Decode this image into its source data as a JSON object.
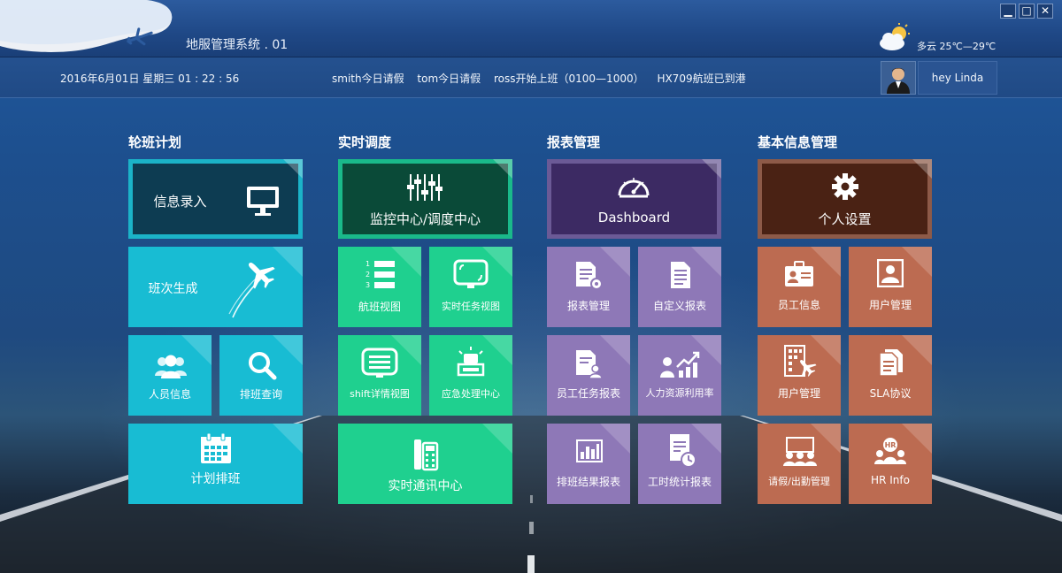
{
  "window": {
    "title": "地服管理系统 . 01",
    "controls": {
      "minimize": "▁",
      "maximize": "□",
      "close": "✕"
    }
  },
  "weather": {
    "text": "多云 25℃—29℃",
    "icon": "cloudy-sun-icon"
  },
  "infobar": {
    "datetime": "2016年6月01日  星期三   01 : 22 : 56",
    "notices": [
      "smith今日请假",
      "tom今日请假",
      "ross开始上班（0100—1000）",
      "HX709航班已到港"
    ],
    "user_greeting": "hey Linda"
  },
  "sections": {
    "rotation": {
      "title": "轮班计划",
      "tiles": {
        "info_entry": "信息录入",
        "shift_gen": "班次生成",
        "staff_info": "人员信息",
        "shift_query": "排班查询",
        "plan_schedule": "计划排班"
      }
    },
    "dispatch": {
      "title": "实时调度",
      "tiles": {
        "monitor": "监控中心/调度中心",
        "flight_view": "航班视图",
        "task_view": "实时任务视图",
        "shift_detail": "shift详情视图",
        "emergency": "应急处理中心",
        "comms": "实时通讯中心"
      }
    },
    "reports": {
      "title": "报表管理",
      "tiles": {
        "dashboard": "Dashboard",
        "report_mgmt": "报表管理",
        "custom_report": "自定义报表",
        "staff_task_report": "员工任务报表",
        "hr_utilization": "人力资源利用率",
        "schedule_result": "排班结果报表",
        "hours_report": "工时统计报表"
      }
    },
    "basic": {
      "title": "基本信息管理",
      "tiles": {
        "personal": "个人设置",
        "employee_info": "员工信息",
        "user_mgmt": "用户管理",
        "user_mgmt2": "用户管理",
        "sla": "SLA协议",
        "leave": "请假/出勤管理",
        "hr_info": "HR Info"
      }
    }
  },
  "colors": {
    "cyan": "#18bcd3",
    "green": "#1fd08f",
    "purple": "#8e78b7",
    "orange": "#bc6b51",
    "banner_cyan": "#0d3c52",
    "banner_green": "#0a4a38",
    "banner_purple": "#3c2a63",
    "banner_orange": "#4a2214"
  }
}
